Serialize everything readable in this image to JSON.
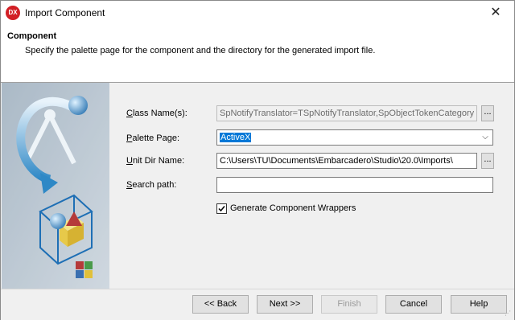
{
  "window": {
    "title": "Import Component",
    "app_icon": "DX",
    "close_glyph": "✕"
  },
  "header": {
    "title": "Component",
    "description": "Specify the palette page for the component and the directory for the generated import file."
  },
  "form": {
    "class_name": {
      "label_pre": "",
      "label_u": "C",
      "label_post": "lass Name(s):",
      "value": "SpNotifyTranslator=TSpNotifyTranslator,SpObjectTokenCategory"
    },
    "palette_page": {
      "label_pre": "",
      "label_u": "P",
      "label_post": "alette Page:",
      "value": "ActiveX"
    },
    "unit_dir": {
      "label_pre": "",
      "label_u": "U",
      "label_post": "nit Dir Name:",
      "value": "C:\\Users\\TU\\Documents\\Embarcadero\\Studio\\20.0\\Imports\\"
    },
    "search_path": {
      "label_pre": "",
      "label_u": "S",
      "label_post": "earch path:",
      "value": ""
    },
    "generate_wrappers": {
      "label": "Generate Component Wrappers",
      "checked": true,
      "check_glyph": "✓"
    },
    "ellipsis_label": "...",
    "dropdown_glyph": "⌵"
  },
  "buttons": {
    "back": "<< Back",
    "next": "Next >>",
    "finish": "Finish",
    "cancel": "Cancel",
    "help": "Help"
  },
  "icons": [
    "app-icon",
    "close-icon",
    "wizard-illustration",
    "dropdown-arrow-icon",
    "checkbox-check-icon",
    "size-grip-icon"
  ]
}
